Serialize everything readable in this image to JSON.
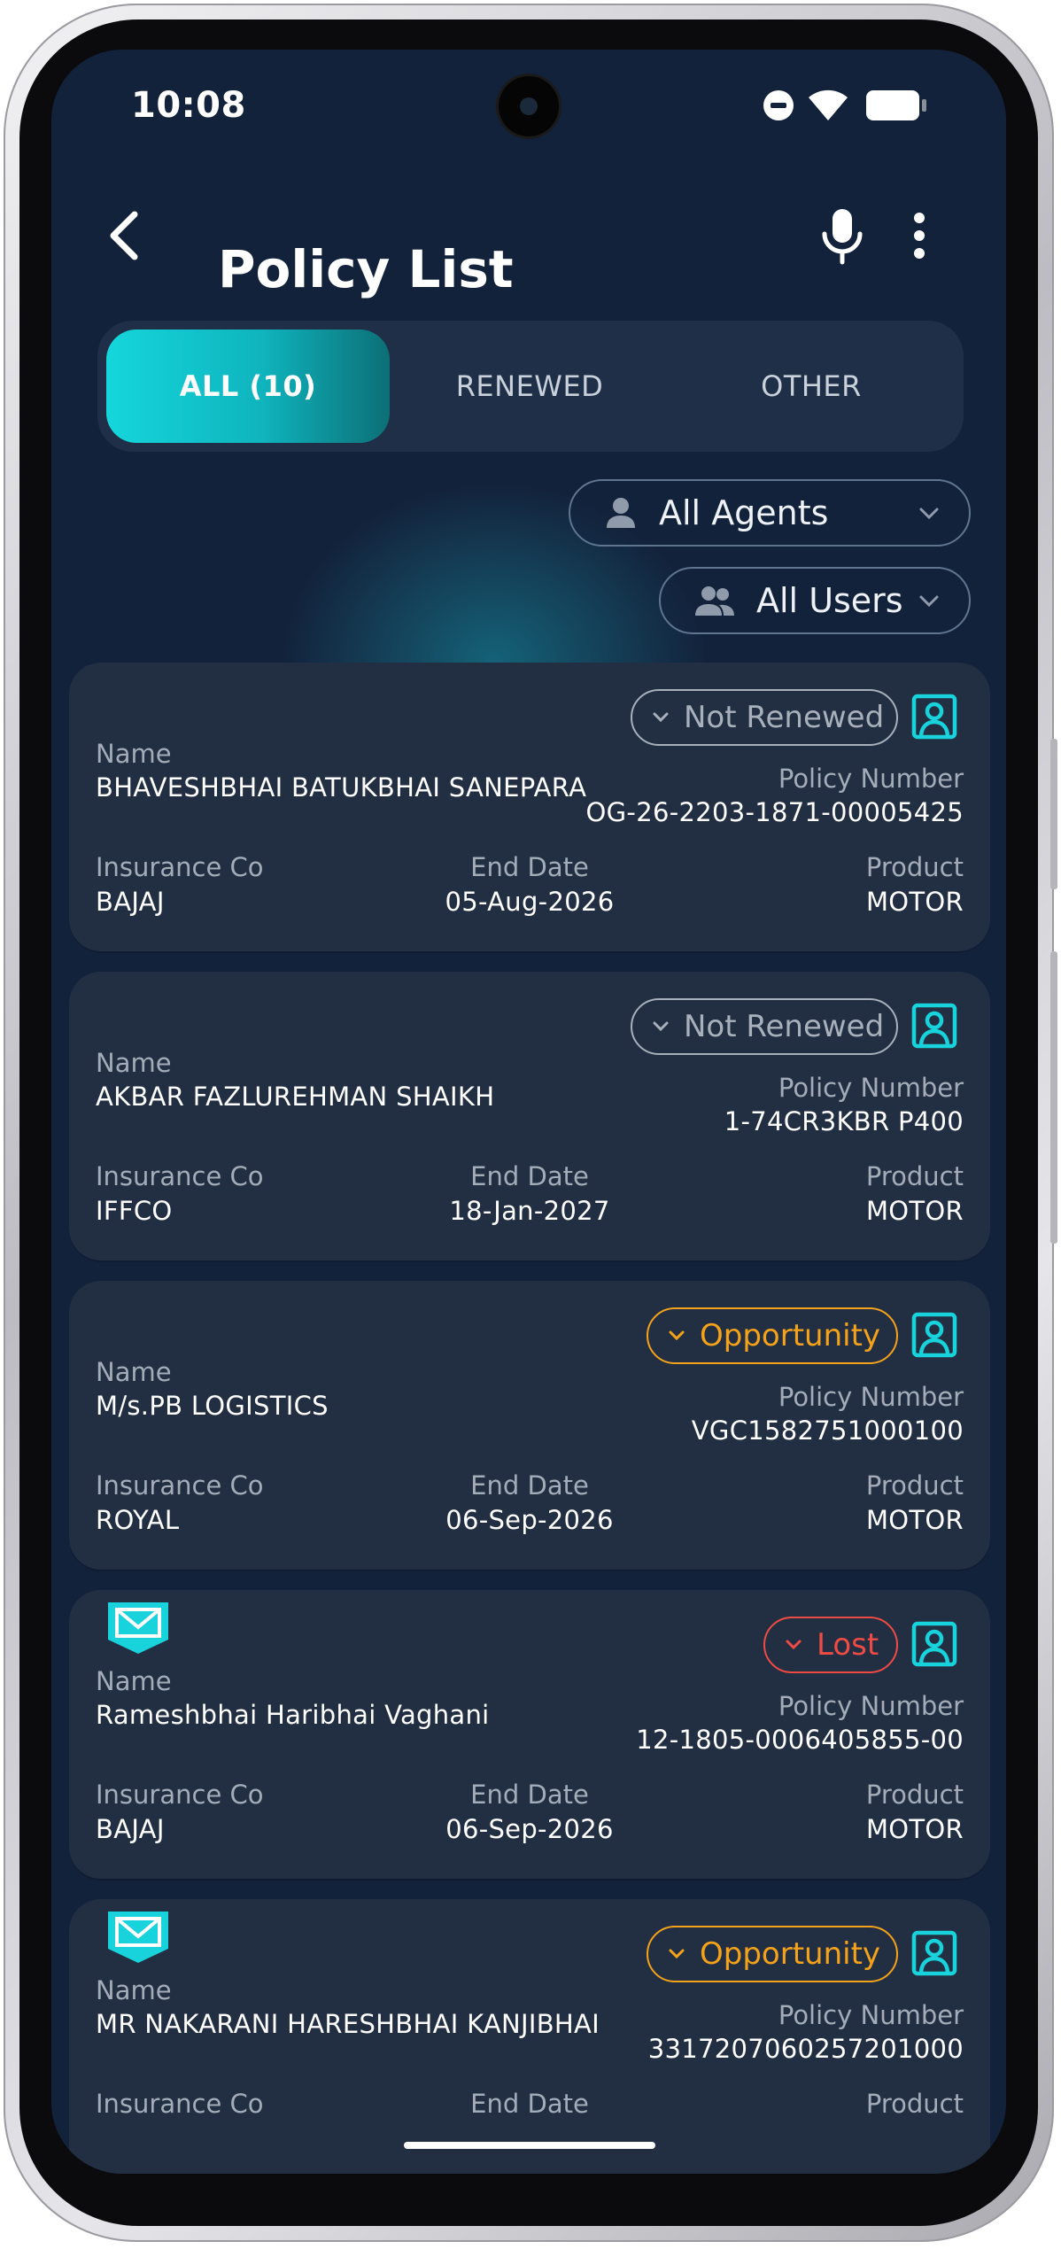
{
  "status_bar": {
    "time": "10:08"
  },
  "header": {
    "title": "Policy List"
  },
  "tabs": [
    {
      "label": "ALL (10)",
      "active": true
    },
    {
      "label": "RENEWED",
      "active": false
    },
    {
      "label": "OTHER",
      "active": false
    }
  ],
  "filters": {
    "agents": "All Agents",
    "users": "All Users"
  },
  "labels": {
    "name": "Name",
    "policy_number": "Policy Number",
    "insurance_co": "Insurance Co",
    "end_date": "End Date",
    "product": "Product"
  },
  "colors": {
    "accent": "#15d6dc",
    "not_renewed": "#a7b0bb",
    "opportunity": "#f5a21b",
    "lost": "#ef4b45"
  },
  "policies": [
    {
      "name": "BHAVESHBHAI BATUKBHAI SANEPARA",
      "policy_number": "OG-26-2203-1871-00005425",
      "insurance_co": "BAJAJ",
      "end_date": "05-Aug-2026",
      "product": "MOTOR",
      "status": "Not Renewed",
      "mail": false
    },
    {
      "name": "AKBAR FAZLUREHMAN SHAIKH",
      "policy_number": "1-74CR3KBR P400",
      "insurance_co": "IFFCO",
      "end_date": "18-Jan-2027",
      "product": "MOTOR",
      "status": "Not Renewed",
      "mail": false
    },
    {
      "name": "M/s.PB LOGISTICS",
      "policy_number": "VGC1582751000100",
      "insurance_co": "ROYAL",
      "end_date": "06-Sep-2026",
      "product": "MOTOR",
      "status": "Opportunity",
      "mail": false
    },
    {
      "name": "Rameshbhai Haribhai Vaghani",
      "policy_number": "12-1805-0006405855-00",
      "insurance_co": "BAJAJ",
      "end_date": "06-Sep-2026",
      "product": "MOTOR",
      "status": "Lost",
      "mail": true
    },
    {
      "name": "MR NAKARANI HARESHBHAI KANJIBHAI",
      "policy_number": "3317207060257201000",
      "insurance_co": "",
      "end_date": "",
      "product": "",
      "status": "Opportunity",
      "mail": true
    }
  ]
}
